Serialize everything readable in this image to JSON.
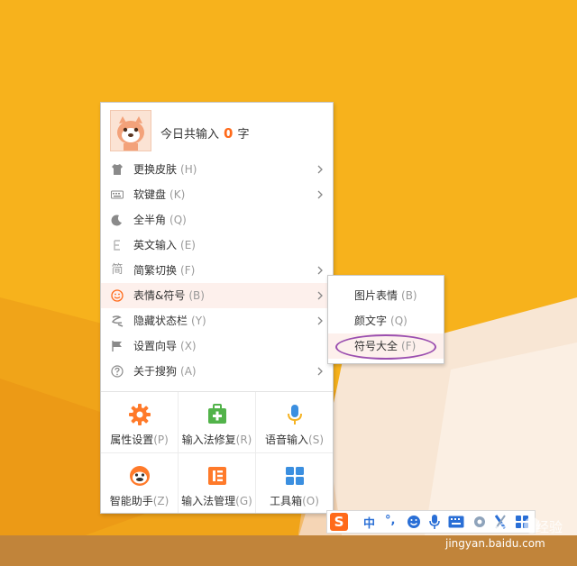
{
  "header": {
    "prefix": "今日共输入",
    "count": "0",
    "suffix": "字"
  },
  "menu_items": [
    {
      "label": "更换皮肤",
      "key": "(H)",
      "arrow": true,
      "icon": "shirt-icon"
    },
    {
      "label": "软键盘",
      "key": "(K)",
      "arrow": true,
      "icon": "keyboard-icon"
    },
    {
      "label": "全半角",
      "key": "(Q)",
      "arrow": false,
      "icon": "moon-icon"
    },
    {
      "label": "英文输入",
      "key": "(E)",
      "arrow": false,
      "icon": "english-icon"
    },
    {
      "label": "简繁切换",
      "key": "(F)",
      "arrow": true,
      "icon": "simplified-icon",
      "icon_char": "简"
    },
    {
      "label": "表情&符号",
      "key": "(B)",
      "arrow": true,
      "icon": "smiley-icon",
      "active": true
    },
    {
      "label": "隐藏状态栏",
      "key": "(Y)",
      "arrow": true,
      "icon": "hide-icon"
    },
    {
      "label": "设置向导",
      "key": "(X)",
      "arrow": false,
      "icon": "flag-icon"
    },
    {
      "label": "关于搜狗",
      "key": "(A)",
      "arrow": true,
      "icon": "help-icon"
    }
  ],
  "tools": [
    {
      "label": "属性设置",
      "key": "(P)",
      "icon": "settings-gear-icon"
    },
    {
      "label": "输入法修复",
      "key": "(R)",
      "icon": "repair-kit-icon"
    },
    {
      "label": "语音输入",
      "key": "(S)",
      "icon": "microphone-icon"
    },
    {
      "label": "智能助手",
      "key": "(Z)",
      "icon": "assistant-icon"
    },
    {
      "label": "输入法管理",
      "key": "(G)",
      "icon": "manage-icon"
    },
    {
      "label": "工具箱",
      "key": "(O)",
      "icon": "toolbox-icon"
    }
  ],
  "submenu": [
    {
      "label": "图片表情",
      "key": "(B)"
    },
    {
      "label": "颜文字",
      "key": "(Q)"
    },
    {
      "label": "符号大全",
      "key": "(F)",
      "highlighted": true
    }
  ],
  "statusbar": {
    "logo": "S",
    "lang": "中",
    "punct": "°,"
  },
  "watermark": {
    "text": "jingyan.baidu.com",
    "brand": "经验"
  },
  "colors": {
    "accent": "#ff6a1a",
    "background": "#f7b21c",
    "highlight_ring": "#9b4fb0"
  }
}
